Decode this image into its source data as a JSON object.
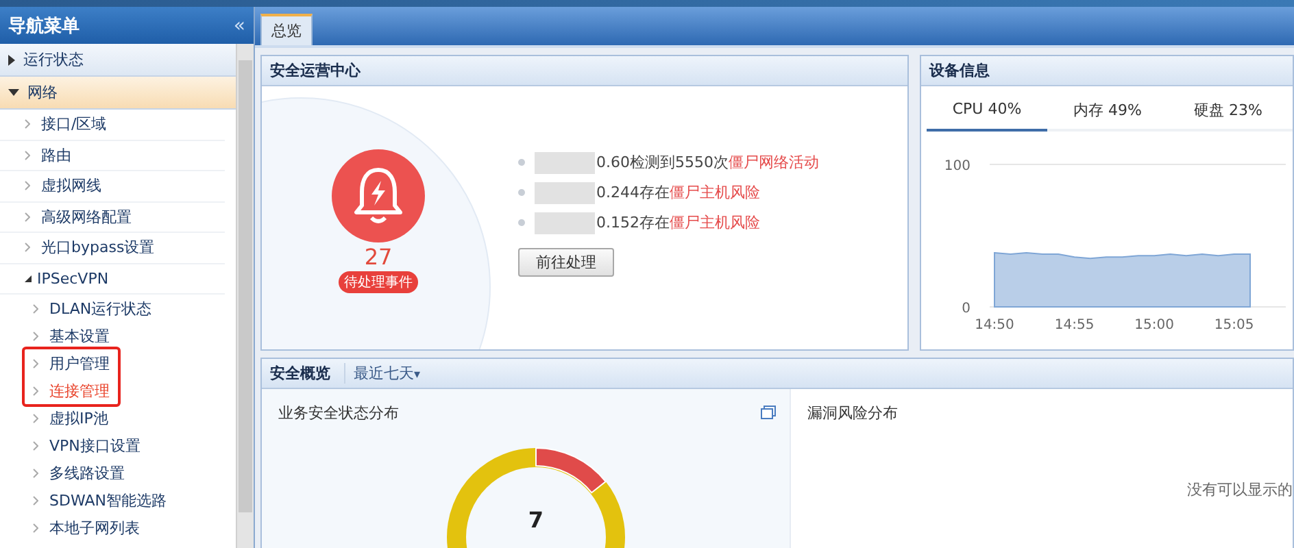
{
  "sidebar": {
    "title": "导航菜单",
    "collapse_glyph": "«",
    "items": [
      {
        "label": "运行状态",
        "expanded": false,
        "selected": false
      },
      {
        "label": "网络",
        "expanded": true,
        "selected": true,
        "children": [
          {
            "label": "接口/区域",
            "expanded": false
          },
          {
            "label": "路由",
            "expanded": false
          },
          {
            "label": "虚拟网线",
            "expanded": false
          },
          {
            "label": "高级网络配置",
            "expanded": false
          },
          {
            "label": "光口bypass设置",
            "expanded": false
          },
          {
            "label": "IPSecVPN",
            "expanded": true,
            "children": [
              {
                "label": "DLAN运行状态",
                "selected": false,
                "marked": false
              },
              {
                "label": "基本设置",
                "selected": false,
                "marked": false
              },
              {
                "label": "用户管理",
                "selected": false,
                "marked": true
              },
              {
                "label": "连接管理",
                "selected": true,
                "marked": true
              },
              {
                "label": "虚拟IP池",
                "selected": false,
                "marked": false
              },
              {
                "label": "VPN接口设置",
                "selected": false,
                "marked": false
              },
              {
                "label": "多线路设置",
                "selected": false,
                "marked": false
              },
              {
                "label": "SDWAN智能选路",
                "selected": false,
                "marked": false
              },
              {
                "label": "本地子网列表",
                "selected": false,
                "marked": false
              }
            ]
          }
        ]
      }
    ]
  },
  "tabs": [
    {
      "label": "总览",
      "selected": true
    }
  ],
  "security_center": {
    "title": "安全运营中心",
    "count": "27",
    "badge": "待处理事件",
    "events": [
      {
        "blurred": true,
        "text": "0.60检测到5550次",
        "risk": "僵尸网络活动"
      },
      {
        "blurred": true,
        "text": "0.244存在",
        "risk": "僵尸主机风险"
      },
      {
        "blurred": true,
        "text": "0.152存在",
        "risk": "僵尸主机风险"
      }
    ],
    "button": "前往处理"
  },
  "device_info": {
    "title": "设备信息",
    "tabs": [
      {
        "label": "CPU 40%",
        "selected": true
      },
      {
        "label": "内存 49%",
        "selected": false
      },
      {
        "label": "硬盘 23%",
        "selected": false
      }
    ],
    "chart_data": {
      "type": "area",
      "categories": [
        "14:50",
        null,
        null,
        null,
        null,
        "14:55",
        null,
        null,
        null,
        null,
        "15:00",
        null,
        null,
        null,
        null,
        "15:05",
        null
      ],
      "series": [
        {
          "color": "#7fa6d6",
          "values": [
            38,
            37,
            38,
            37,
            37,
            35,
            34,
            35,
            35,
            36,
            36,
            37,
            36,
            37,
            36,
            37,
            37
          ]
        }
      ],
      "ylim": [
        0,
        100
      ],
      "yticks": [
        0,
        100
      ]
    }
  },
  "overview": {
    "title": "安全概览",
    "range": "最近七天",
    "range_caret": "▾",
    "business": {
      "title": "业务安全状态分布",
      "count": "7"
    },
    "vulnerability": {
      "title": "漏洞风险分布",
      "empty": "没有可以显示的"
    }
  }
}
